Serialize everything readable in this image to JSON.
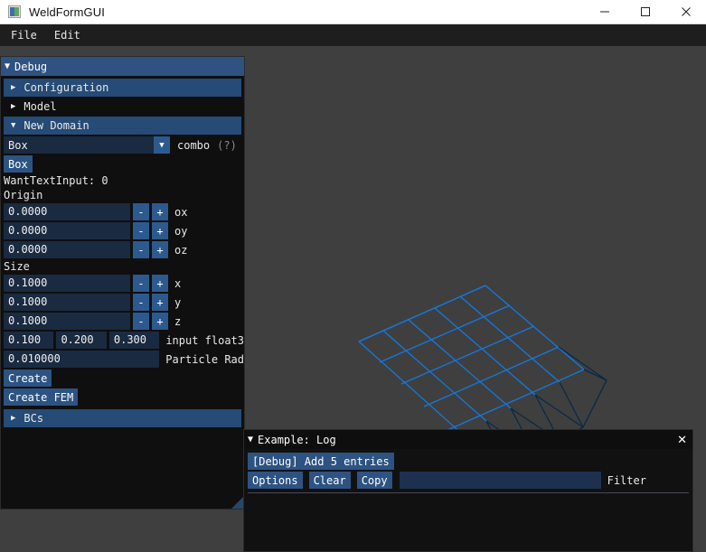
{
  "window": {
    "title": "WeldFormGUI",
    "icon": "app-icon",
    "minimize": "—",
    "maximize": "□",
    "close": "✕"
  },
  "menubar": {
    "items": [
      {
        "label": "File"
      },
      {
        "label": "Edit"
      }
    ]
  },
  "debug_panel": {
    "title": "Debug",
    "collapse_arrow": "▼",
    "tree": [
      {
        "label": "Configuration",
        "arrow": "▶",
        "expanded": false,
        "highlighted": true
      },
      {
        "label": "Model",
        "arrow": "▶",
        "expanded": false,
        "highlighted": false
      },
      {
        "label": "New Domain",
        "arrow": "▼",
        "expanded": true,
        "highlighted": true
      }
    ],
    "combo": {
      "value": "Box",
      "arrow": "▼",
      "label": "combo",
      "help": "(?)"
    },
    "shape_button": "Box",
    "want_text_input": "WantTextInput: 0",
    "origin_label": "Origin",
    "origin_fields": [
      {
        "value": "0.0000",
        "minus": "-",
        "plus": "+",
        "label": "ox"
      },
      {
        "value": "0.0000",
        "minus": "-",
        "plus": "+",
        "label": "oy"
      },
      {
        "value": "0.0000",
        "minus": "-",
        "plus": "+",
        "label": "oz"
      }
    ],
    "size_label": "Size",
    "size_fields": [
      {
        "value": "0.1000",
        "minus": "-",
        "plus": "+",
        "label": "x"
      },
      {
        "value": "0.1000",
        "minus": "-",
        "plus": "+",
        "label": "y"
      },
      {
        "value": "0.1000",
        "minus": "-",
        "plus": "+",
        "label": "z"
      }
    ],
    "float3": {
      "values": [
        "0.100",
        "0.200",
        "0.300"
      ],
      "label": "input float3"
    },
    "particle_radius": {
      "value": "0.010000",
      "label": "Particle Rad"
    },
    "create_button": "Create",
    "create_fem_button": "Create FEM",
    "bcs": {
      "label": "BCs",
      "arrow": "▶"
    }
  },
  "log_panel": {
    "title": "Example: Log",
    "collapse_arrow": "▼",
    "close": "✕",
    "add_entries_button": "[Debug] Add 5 entries",
    "options_button": "Options",
    "clear_button": "Clear",
    "copy_button": "Copy",
    "filter_value": "",
    "filter_label": "Filter"
  },
  "viewport": {
    "background": "#3f3f3f",
    "mesh_bright_color": "#1478e0",
    "mesh_dark_color": "#0a2540",
    "mesh_highlight_color": "#12d8c0"
  },
  "colors": {
    "accent": "#2d5a8e",
    "panel_bg": "#0f0f0f",
    "header_bg": "#2f5280",
    "field_bg": "#1a2a40"
  }
}
